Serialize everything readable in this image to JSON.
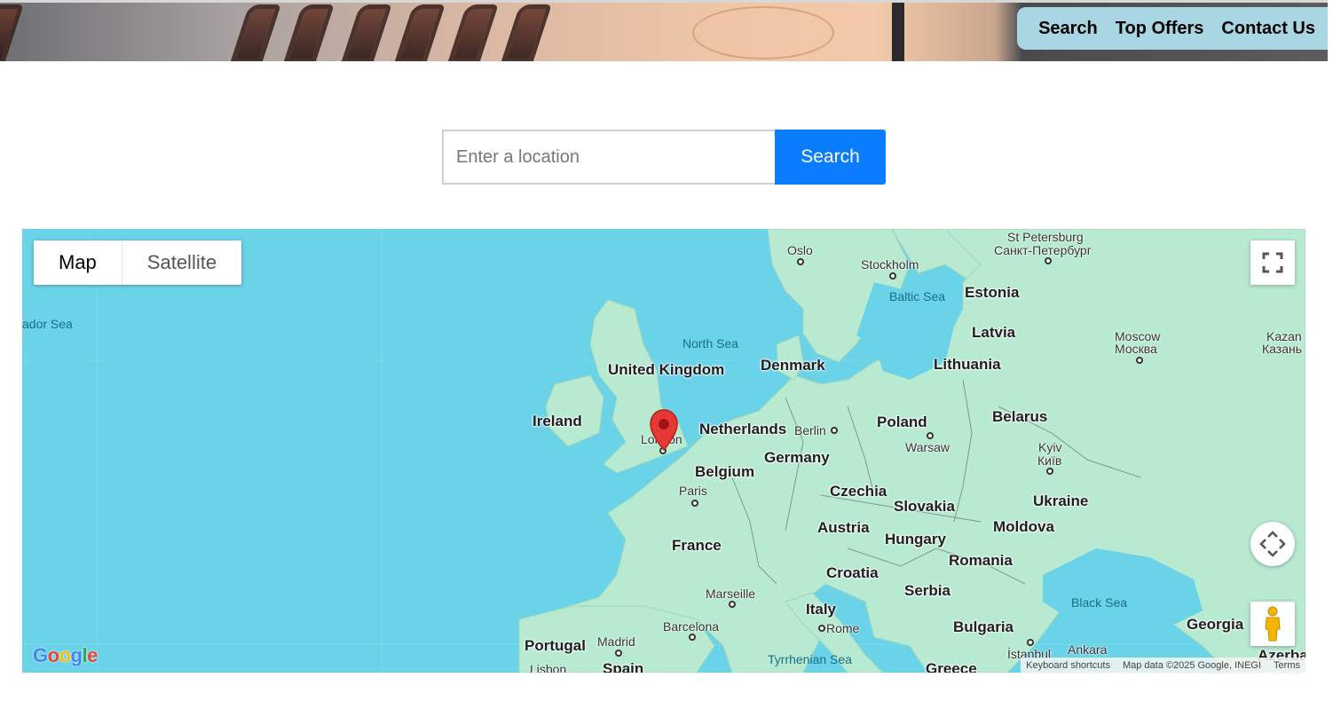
{
  "header": {
    "nav": [
      "Search",
      "Top Offers",
      "Contact Us"
    ]
  },
  "search": {
    "placeholder": "Enter a location",
    "button_label": "Search"
  },
  "map": {
    "type_buttons": {
      "map": "Map",
      "satellite": "Satellite"
    },
    "controls": [
      "fullscreen-icon",
      "camera-control-icon",
      "street-view-pegman-icon"
    ],
    "marker": {
      "icon": "map-pin-icon",
      "color": "#e53935",
      "place": "London"
    },
    "country_labels": {
      "uk": "United Kingdom",
      "ireland": "Ireland",
      "netherlands": "Netherlands",
      "belgium": "Belgium",
      "germany": "Germany",
      "denmark": "Denmark",
      "france": "France",
      "czechia": "Czechia",
      "austria": "Austria",
      "slovakia": "Slovakia",
      "hungary": "Hungary",
      "croatia": "Croatia",
      "serbia": "Serbia",
      "romania": "Romania",
      "moldova": "Moldova",
      "ukraine": "Ukraine",
      "poland": "Poland",
      "belarus": "Belarus",
      "lithuania": "Lithuania",
      "latvia": "Latvia",
      "estonia": "Estonia",
      "italy": "Italy",
      "bulgaria": "Bulgaria",
      "portugal": "Portugal",
      "spain": "Spain",
      "greece": "Greece",
      "georgia": "Georgia",
      "azerbaijan": "Azerbaijan"
    },
    "city_labels": {
      "london": "London",
      "paris": "Paris",
      "berlin": "Berlin",
      "warsaw": "Warsaw",
      "oslo": "Oslo",
      "stockholm": "Stockholm",
      "st_petersburg": "St Petersburg",
      "st_petersburg_local": "Санкт-Петербург",
      "moscow": "Moscow",
      "moscow_local": "Москва",
      "kazan": "Kazan",
      "kazan_local": "Казань",
      "kyiv": "Kyiv",
      "kyiv_local": "Київ",
      "marseille": "Marseille",
      "barcelona": "Barcelona",
      "madrid": "Madrid",
      "rome": "Rome",
      "lisbon": "Lisbon",
      "istanbul": "İstanbul",
      "ankara": "Ankara"
    },
    "sea_labels": {
      "labrador": "ador Sea",
      "north_sea": "North Sea",
      "baltic": "Baltic Sea",
      "black_sea": "Black Sea",
      "tyrrhenian": "Tyrrhenian Sea"
    },
    "logo": "Google",
    "attribution": {
      "shortcuts": "Keyboard shortcuts",
      "data": "Map data ©2025 Google, INEGI",
      "terms": "Terms"
    }
  },
  "colors": {
    "nav_bg": "#a9d6e3",
    "search_button": "#0a7cff",
    "water": "#6ad3e8",
    "land": "#b7ead0"
  }
}
